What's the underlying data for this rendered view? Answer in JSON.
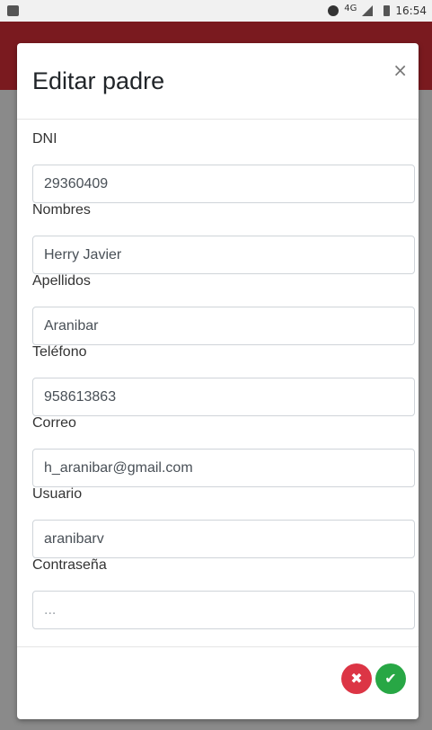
{
  "status_bar": {
    "network": "4G",
    "time": "16:54"
  },
  "modal": {
    "title": "Editar padre",
    "close_glyph": "×"
  },
  "form": {
    "fields": [
      {
        "label": "DNI",
        "value": "29360409",
        "placeholder": ""
      },
      {
        "label": "Nombres",
        "value": "Herry Javier",
        "placeholder": ""
      },
      {
        "label": "Apellidos",
        "value": "Aranibar",
        "placeholder": ""
      },
      {
        "label": "Teléfono",
        "value": "958613863",
        "placeholder": ""
      },
      {
        "label": "Correo",
        "value": "h_aranibar@gmail.com",
        "placeholder": ""
      },
      {
        "label": "Usuario",
        "value": "aranibarv",
        "placeholder": ""
      },
      {
        "label": "Contraseña",
        "value": "",
        "placeholder": "..."
      }
    ]
  },
  "footer": {
    "cancel_glyph": "✖",
    "confirm_glyph": "✔"
  },
  "colors": {
    "header_bg": "#7a1a1f",
    "cancel": "#dc3545",
    "confirm": "#28a745"
  },
  "icons": [
    "image-icon",
    "alarm-icon",
    "signal-icon",
    "battery-icon",
    "close-icon",
    "cancel-icon",
    "check-icon"
  ]
}
